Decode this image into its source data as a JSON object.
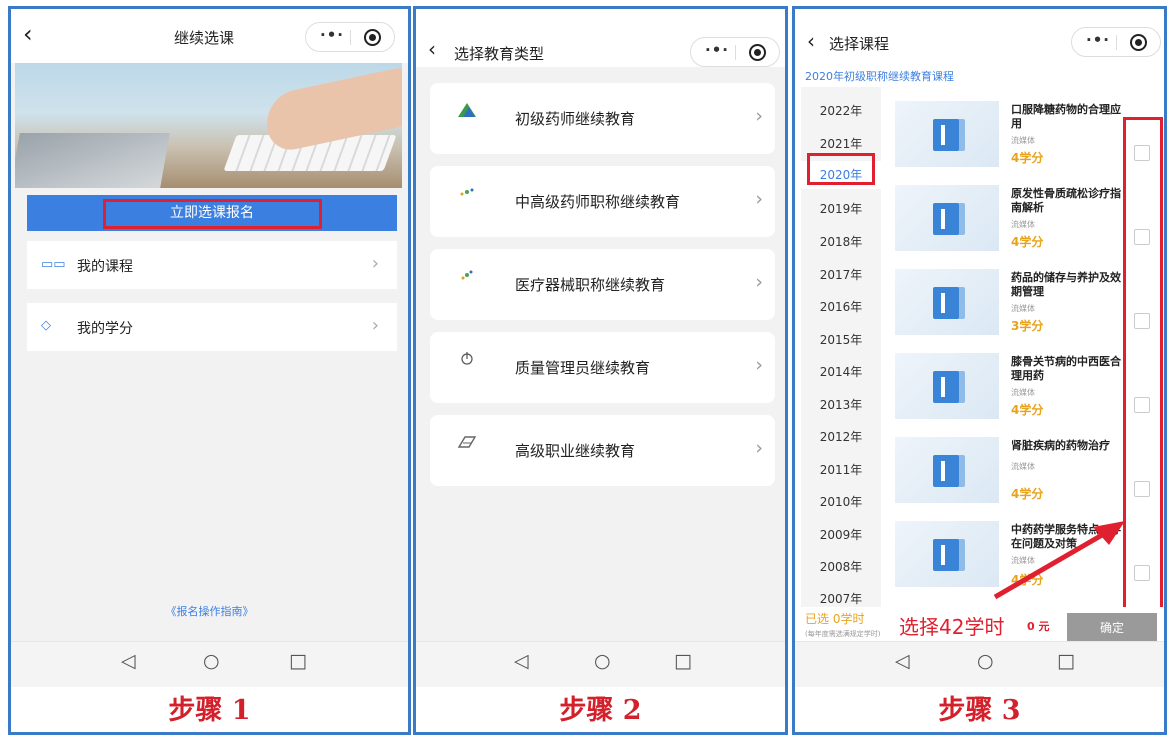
{
  "panel1": {
    "title": "继续选课",
    "cta": "立即选课报名",
    "rows": [
      {
        "icon": "book-open-icon",
        "label": "我的课程"
      },
      {
        "icon": "graduation-cap-icon",
        "label": "我的学分"
      }
    ],
    "guide": "《报名操作指南》",
    "step": "步骤 1"
  },
  "panel2": {
    "title": "选择教育类型",
    "items": [
      {
        "label": "初级药师继续教育",
        "logo": "pharmacist-logo"
      },
      {
        "label": "中高级药师职称继续教育",
        "logo": "pharmacist-logo"
      },
      {
        "label": "医疗器械职称继续教育",
        "logo": "medical-device-logo"
      },
      {
        "label": "质量管理员继续教育",
        "logo": "quality-logo"
      },
      {
        "label": "高级职业继续教育",
        "logo": "vocational-logo"
      }
    ],
    "step": "步骤 2"
  },
  "panel3": {
    "title": "选择课程",
    "subtitle": "2020年初级职称继续教育课程",
    "years": [
      "2022年",
      "2021年",
      "2020年",
      "2019年",
      "2018年",
      "2017年",
      "2016年",
      "2015年",
      "2014年",
      "2013年",
      "2012年",
      "2011年",
      "2010年",
      "2009年",
      "2008年",
      "2007年"
    ],
    "selected_year": "2020年",
    "courses": [
      {
        "title": "口服降糖药物的合理应用",
        "medium": "流媒体",
        "credits": "4学分"
      },
      {
        "title": "原发性骨质疏松诊疗指南解析",
        "medium": "流媒体",
        "credits": "4学分"
      },
      {
        "title": "药品的储存与养护及效期管理",
        "medium": "流媒体",
        "credits": "3学分"
      },
      {
        "title": "膝骨关节病的中西医合理用药",
        "medium": "流媒体",
        "credits": "4学分"
      },
      {
        "title": "肾脏疾病的药物治疗",
        "medium": "流媒体",
        "credits": "4学分"
      },
      {
        "title": "中药药学服务特点、存在问题及对策",
        "medium": "流媒体",
        "credits": "4学分"
      }
    ],
    "bottom": {
      "selected": "已选 0学时",
      "hint": "(每年度需选满规定学时)",
      "annotation": "选择42学时",
      "price": "0 元",
      "confirm": "确定"
    },
    "step": "步骤 3"
  },
  "nav": {
    "back": "◁",
    "home": "○",
    "recent": "□"
  },
  "colors": {
    "accent": "#3b7fe0",
    "highlight": "#e0202e",
    "credit": "#e9a31b",
    "frame": "#3a7bc8"
  }
}
